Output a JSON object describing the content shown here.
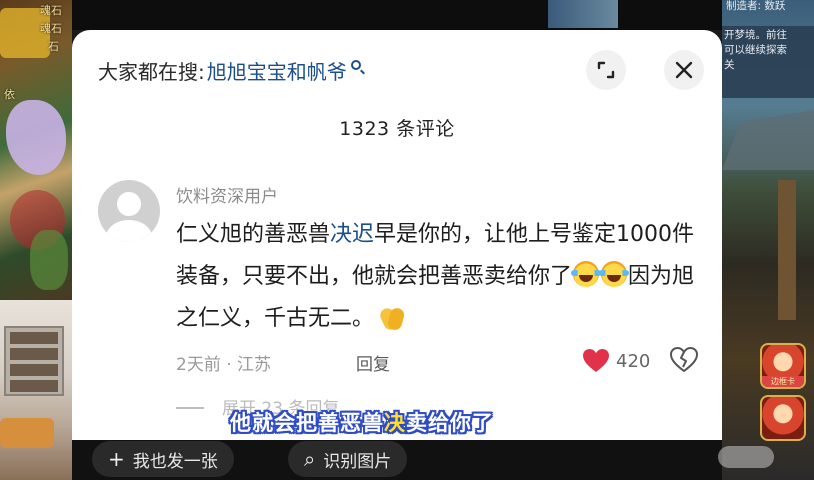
{
  "search": {
    "prefix": "大家都在搜:",
    "term": "旭旭宝宝和帆爷"
  },
  "comments_header": {
    "count_label": "1323 条评论"
  },
  "comment": {
    "username": "饮料资深用户",
    "text_part1": "仁义旭的善恶兽",
    "text_highlight": "决迟",
    "text_part2": "早是你的，让他上号鉴定1000件装备，只要不出，他就会把善恶卖给你了",
    "text_part3": "因为旭之仁义，千古无二。",
    "time_location": "2天前 · 江苏",
    "reply_label": "回复",
    "like_count": "420"
  },
  "next_comment_peek": "展开 23 条回复",
  "subtitle": {
    "part1": "他就会把善恶兽",
    "part2": "决",
    "part3": "卖给你了"
  },
  "bottom_bar": {
    "post_image_label": "我也发一张",
    "recognize_label": "识别图片"
  },
  "background_overlay": {
    "left_game_texts": [
      "魂石",
      "魂石",
      "石",
      "依"
    ],
    "right_game_texts": [
      "制造者: 数跃",
      "开梦境。前往",
      "可以继续探索",
      "关"
    ],
    "avatar_card_label": "边框卡"
  },
  "colors": {
    "link_blue": "#1c4f8a",
    "heart_red": "#e0334b",
    "subtitle_outline": "#2f4cc4",
    "subtitle_yellow": "#ffe12a"
  },
  "icons": {
    "expand": "expand-icon",
    "close": "close-icon",
    "search": "search-icon",
    "like": "heart-icon",
    "dislike": "broken-heart-icon"
  }
}
